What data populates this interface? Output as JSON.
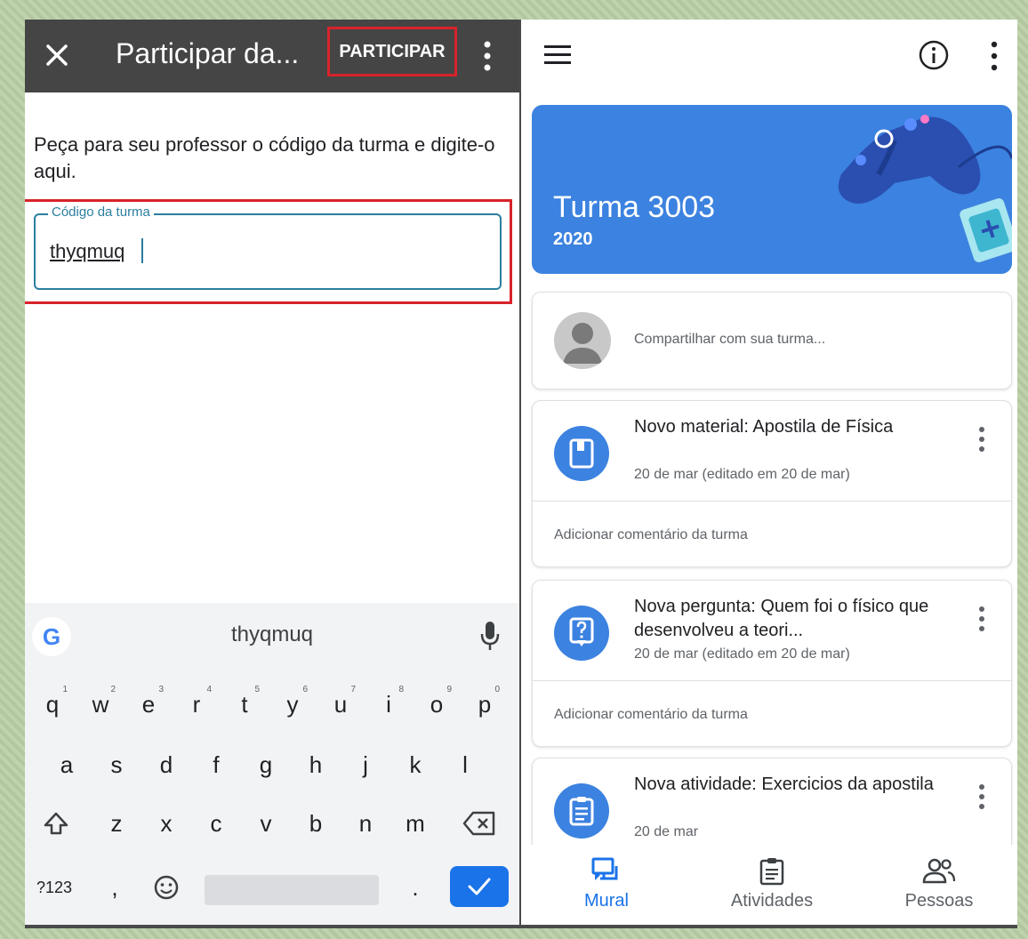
{
  "join_panel": {
    "title": "Participar da...",
    "join_label": "PARTICIPAR",
    "instruction": "Peça para seu professor o código da turma e digite-o aqui.",
    "field_label": "Código da turma",
    "field_value": "thyqmuq"
  },
  "keyboard": {
    "suggestion": "thyqmuq",
    "row1": [
      {
        "k": "q",
        "n": "1"
      },
      {
        "k": "w",
        "n": "2"
      },
      {
        "k": "e",
        "n": "3"
      },
      {
        "k": "r",
        "n": "4"
      },
      {
        "k": "t",
        "n": "5"
      },
      {
        "k": "y",
        "n": "6"
      },
      {
        "k": "u",
        "n": "7"
      },
      {
        "k": "i",
        "n": "8"
      },
      {
        "k": "o",
        "n": "9"
      },
      {
        "k": "p",
        "n": "0"
      }
    ],
    "row2": [
      "a",
      "s",
      "d",
      "f",
      "g",
      "h",
      "j",
      "k",
      "l"
    ],
    "row3": [
      "z",
      "x",
      "c",
      "v",
      "b",
      "n",
      "m"
    ],
    "symbols_label": "?123",
    "comma": ",",
    "period": "."
  },
  "class_panel": {
    "class_name": "Turma 3003",
    "class_year": "2020",
    "share_placeholder": "Compartilhar com sua turma...",
    "posts": [
      {
        "title": "Novo material: Apostila de Física",
        "date": "20 de mar (editado em 20 de mar)",
        "comment": "Adicionar comentário da turma",
        "icon": "book-icon"
      },
      {
        "title": "Nova pergunta: Quem foi o físico que desenvolveu a teori...",
        "date": "20 de mar (editado em 20 de mar)",
        "comment": "Adicionar comentário da turma",
        "icon": "question-icon"
      },
      {
        "title": "Nova atividade: Exercicios da apostila",
        "date": "20 de mar",
        "icon": "assignment-icon"
      }
    ],
    "nav": [
      "Mural",
      "Atividades",
      "Pessoas"
    ]
  },
  "colors": {
    "accent_blue": "#1a73e8",
    "banner_blue": "#3c82e0",
    "highlight_red": "#d8232a",
    "topbar_dark": "#454545"
  }
}
